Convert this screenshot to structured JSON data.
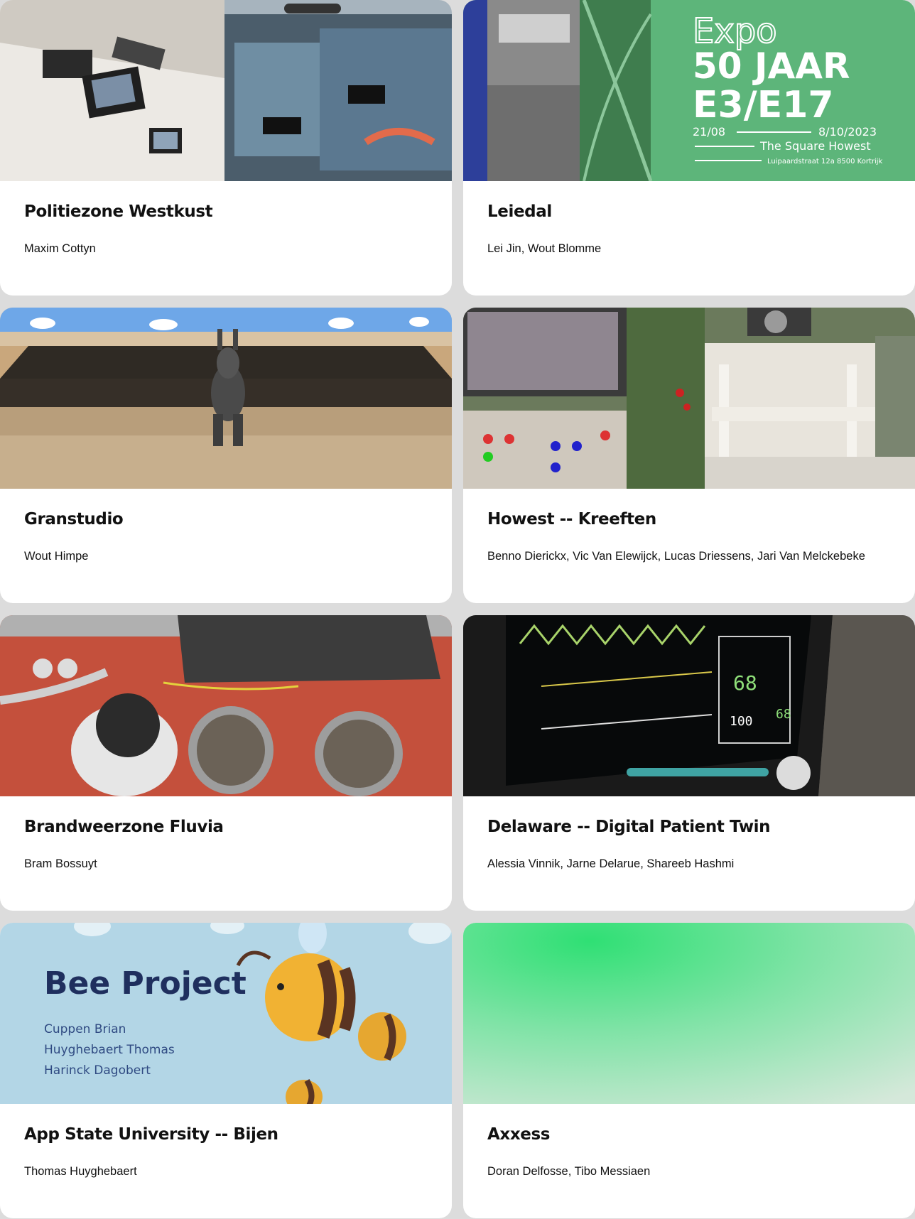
{
  "projects": [
    {
      "title": "Politiezone Westkust",
      "authors": "Maxim Cottyn",
      "image": "drone-lab-photo"
    },
    {
      "title": "Leiedal",
      "authors": "Lei Jin, Wout Blomme",
      "image": "expo-poster",
      "poster": {
        "line1": "Expo",
        "line2": "50 JAAR",
        "line3": "E3/E17",
        "date_from": "21/08",
        "date_to": "8/10/2023",
        "venue": "The Square Howest",
        "address": "Luipaardstraat 12a 8500 Kortrijk"
      }
    },
    {
      "title": "Granstudio",
      "authors": "Wout Himpe",
      "image": "3d-horse-render"
    },
    {
      "title": "Howest -- Kreeften",
      "authors": "Benno Dierickx, Vic Van Elewijck, Lucas Driessens, Jari Van Melckebeke",
      "image": "greenhouse-robot-photo"
    },
    {
      "title": "Brandweerzone Fluvia",
      "authors": "Bram Bossuyt",
      "image": "camera-sirens-photo"
    },
    {
      "title": "Delaware -- Digital Patient Twin",
      "authors": "Alessia Vinnik, Jarne Delarue, Shareeb Hashmi",
      "image": "patient-monitor-photo",
      "monitor": {
        "hr": "68",
        "spo2": "100",
        "spo2b": "68"
      }
    },
    {
      "title": "App State University -- Bijen",
      "authors": "Thomas Huyghebaert",
      "image": "bee-project-slide",
      "slide": {
        "heading": "Bee Project",
        "names": [
          "Cuppen Brian",
          "Huyghebaert Thomas",
          "Harinck Dagobert"
        ]
      }
    },
    {
      "title": "Axxess",
      "authors": "Doran Delfosse, Tibo Messiaen",
      "image": "green-gradient"
    }
  ],
  "colors": {
    "page_bg": "#dcdcdc",
    "card_bg": "#ffffff",
    "expo_green": "#5db57a",
    "expo_blue": "#2d3f9a"
  }
}
